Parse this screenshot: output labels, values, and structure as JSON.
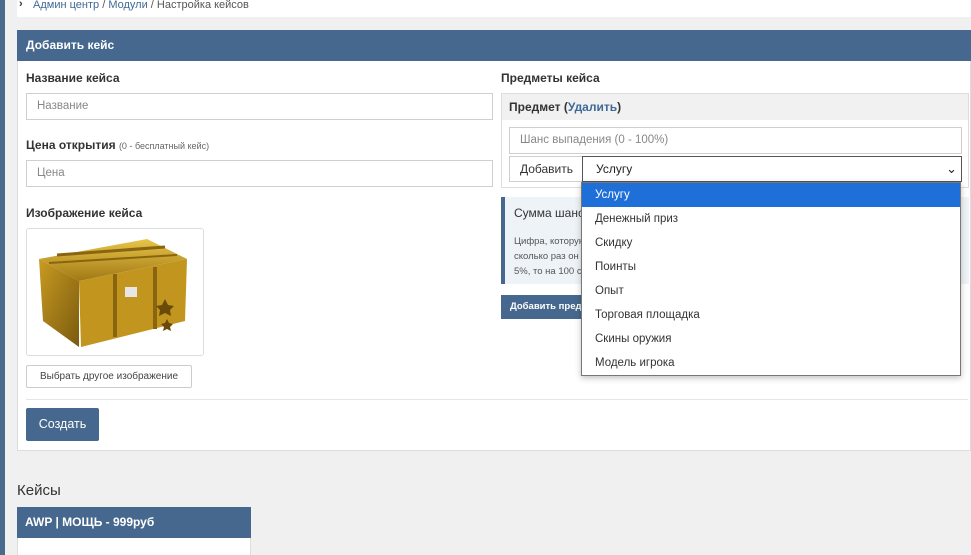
{
  "breadcrumb": {
    "items": [
      "Админ центр",
      "Модули",
      "Настройка кейсов"
    ],
    "separator": "/"
  },
  "form": {
    "header": "Добавить кейс",
    "name_label": "Название кейса",
    "name_placeholder": "Название",
    "price_label": "Цена открытия",
    "price_hint": "(0 - бесплатный кейс)",
    "price_placeholder": "Цена",
    "image_label": "Изображение кейса",
    "change_image_button": "Выбрать другое изображение",
    "create_button": "Создать"
  },
  "items": {
    "label": "Предметы кейса",
    "item_header": "Предмет",
    "delete_link": "Удалить",
    "chance_placeholder": "Шанс выпадения (0 - 100%)",
    "add_label": "Добавить",
    "selected_type": "Услугу",
    "info_title": "Сумма шансов",
    "info_lines": [
      "Цифра, которую",
      "сколько раз он",
      "5%, то на 100 с"
    ],
    "add_item_button": "Добавить предмет"
  },
  "dropdown": {
    "options": [
      "Услугу",
      "Денежный приз",
      "Скидку",
      "Поинты",
      "Опыт",
      "Торговая площадка",
      "Скины оружия",
      "Модель игрока"
    ],
    "selected_index": 0
  },
  "cases": {
    "title": "Кейсы",
    "list": [
      {
        "name": "AWP | МОЩЬ - 999руб"
      }
    ]
  },
  "colors": {
    "accent": "#46688e",
    "link": "#3f6a98",
    "selected_option": "#1f6fd8"
  }
}
